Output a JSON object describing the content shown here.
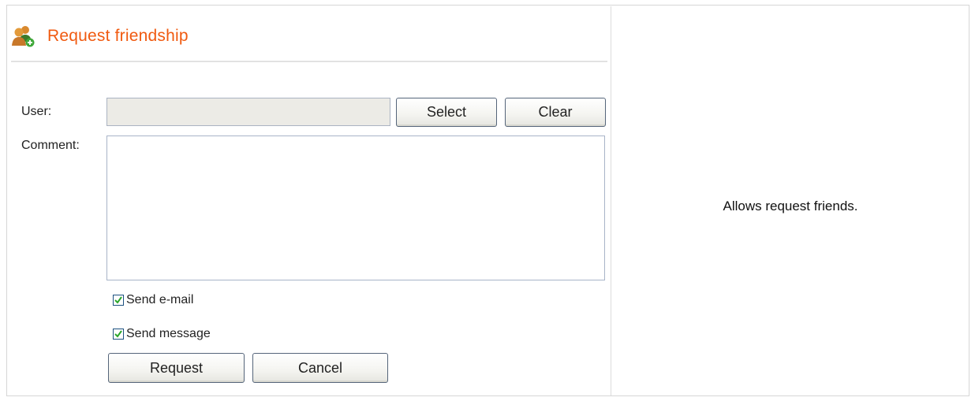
{
  "header": {
    "title": "Request friendship",
    "icon": "users-add-icon"
  },
  "form": {
    "user_label": "User:",
    "user_value": "",
    "select_label": "Select",
    "clear_label": "Clear",
    "comment_label": "Comment:",
    "comment_value": "",
    "send_email_label": "Send e-mail",
    "send_email_checked": true,
    "send_message_label": "Send message",
    "send_message_checked": true,
    "request_label": "Request",
    "cancel_label": "Cancel"
  },
  "description": "Allows request friends.",
  "colors": {
    "title": "#f05a10",
    "checkmark": "#2aa52a",
    "button_border": "#55657a"
  }
}
